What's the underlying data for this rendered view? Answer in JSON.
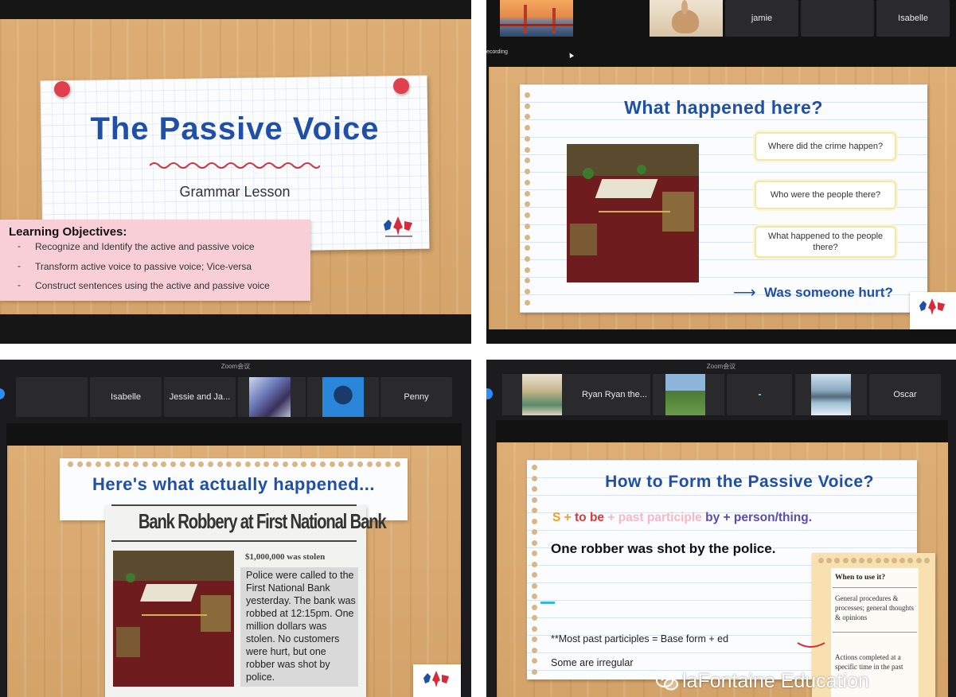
{
  "q1": {
    "title": "The Passive Voice",
    "subtitle": "Grammar Lesson",
    "objectives_heading": "Learning Objectives:",
    "objectives": [
      "Recognize and Identify the active and passive voice",
      "Transform active voice to passive voice; Vice-versa",
      "Construct sentences using the active and passive voice"
    ],
    "bullet": "-"
  },
  "q2": {
    "participants": [
      "jamie",
      "Isabelle"
    ],
    "recording_label": "ecording",
    "heading": "What happened here?",
    "questions": [
      "Where did the crime happen?",
      "Who were the people there?",
      "What happened to the people there?"
    ],
    "arrow": "⟶",
    "followup": "Was someone hurt?"
  },
  "q3": {
    "window_title": "Zoom会议",
    "participants": [
      "Isabelle",
      "Jessie and Ja...",
      "Penny"
    ],
    "heading": "Here's what actually happened...",
    "headline": "Bank Robbery at First National Bank",
    "subhead": "$1,000,000 was stolen",
    "article": "Police were called to the First National Bank yesterday. The bank was robbed at 12:15pm. One million dollars was stolen. No customers were hurt, but one robber was shot by police."
  },
  "q4": {
    "window_title": "Zoom会议",
    "participants": [
      "Ryan Ryan the...",
      "Oscar"
    ],
    "heading": "How to Form the Passive Voice?",
    "formula": {
      "s": "S",
      "plus1": " + ",
      "to_be": "to be",
      "plus2": " + ",
      "pp": "past participle",
      "by": " by",
      "plus3": " + ",
      "person": "person/thing."
    },
    "example": "One robber was shot by the police.",
    "note1": "**Most past participles = Base form + ed",
    "note2": "Some are irregular",
    "card_title": "When to use it?",
    "card_item1": "General procedures & processes; general thoughts & opinions",
    "card_item2": "Actions completed at a specific time in the past"
  },
  "watermark": "laFontaine Education",
  "colors": {
    "title_blue": "#1f4fa6",
    "orange": "#f0a024",
    "red": "#e0373a",
    "pink": "#f7b7c4",
    "purple": "#5a4bb0",
    "pink_panel": "#f8cfd6"
  }
}
